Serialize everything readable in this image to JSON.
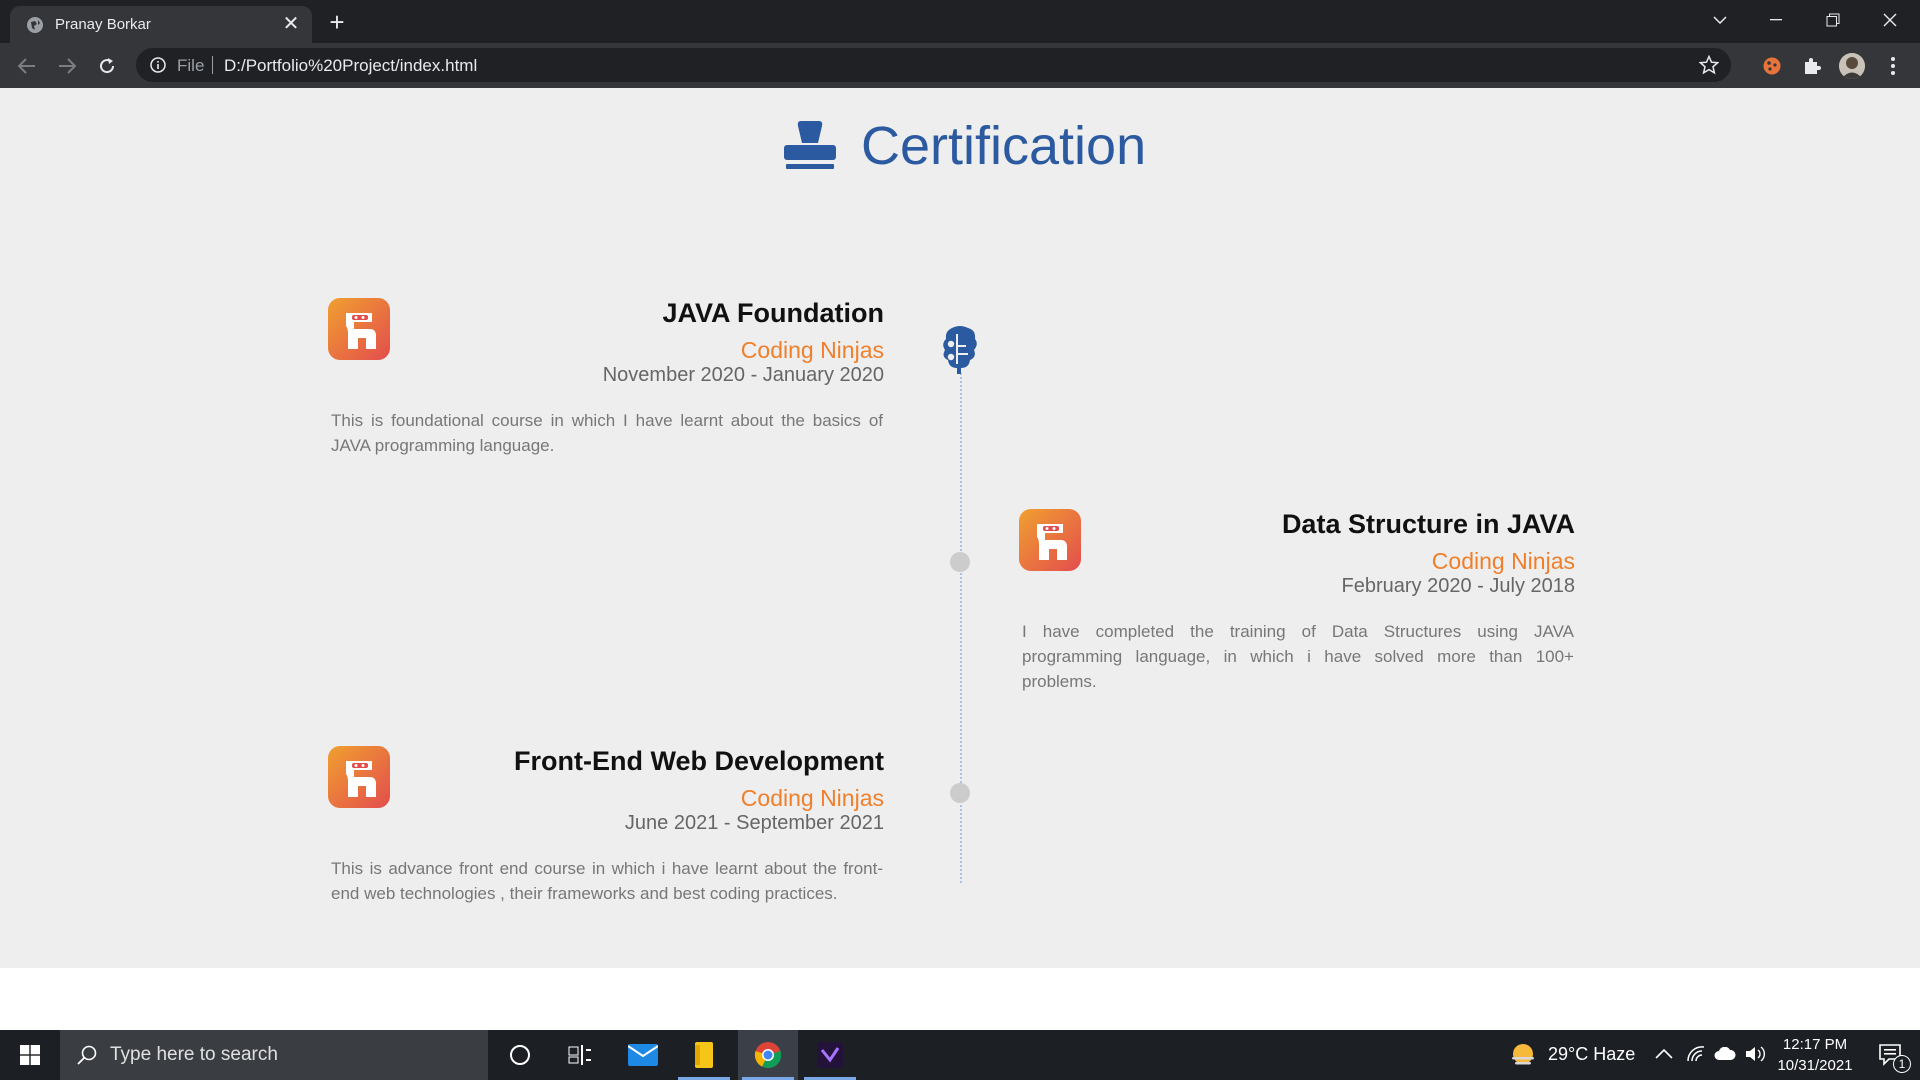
{
  "browser": {
    "tab_title": "Pranay Borkar",
    "omnibox": {
      "scheme_label": "File",
      "url": "D:/Portfolio%20Project/index.html"
    }
  },
  "page": {
    "heading": "Certification",
    "certifications": [
      {
        "title": "JAVA Foundation",
        "org": "Coding Ninjas",
        "dates": "November 2020 - January 2020",
        "description": "This is foundational course in which I have learnt about the basics of JAVA programming language."
      },
      {
        "title": "Data Structure in JAVA",
        "org": "Coding Ninjas",
        "dates": "February 2020 - July 2018",
        "description": "I have completed the training of Data Structures using JAVA programming language, in which i have solved more than 100+ problems."
      },
      {
        "title": "Front-End Web Development",
        "org": "Coding Ninjas",
        "dates": "June 2021 - September 2021",
        "description": "This is advance front end course in which i have learnt about the front-end web technologies , their frameworks and best coding practices."
      }
    ],
    "colors": {
      "heading": "#2c5aa0",
      "org": "#f07f2c",
      "background": "#eeeeee"
    }
  },
  "taskbar": {
    "search_placeholder": "Type here to search",
    "weather": "29°C  Haze",
    "time": "12:17 PM",
    "date": "10/31/2021",
    "notification_count": "1"
  }
}
